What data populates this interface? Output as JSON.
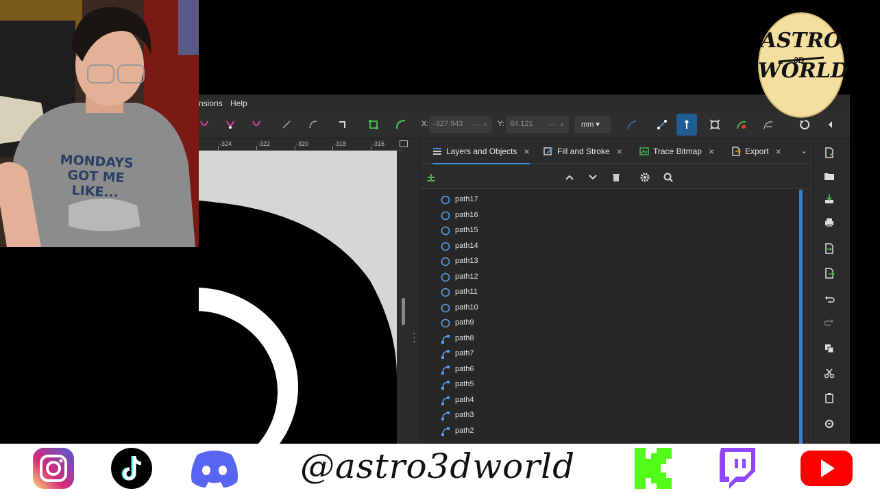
{
  "menu": {
    "partial_item": "nsions",
    "help": "Help"
  },
  "toolbar": {
    "x_label": "X:",
    "x_value": "-327.943",
    "y_label": "Y:",
    "y_value": "84.121",
    "unit": "mm ▾",
    "stepper_symbols": "— +",
    "icons": [
      "node-join-icon",
      "node-break-icon",
      "node-delete-icon",
      "segment-line-icon",
      "segment-curve-icon",
      "node-cusp-icon",
      "object-to-path-icon",
      "stroke-to-path-icon",
      "path-outline-icon",
      "bspline-icon",
      "show-handles-icon",
      "transform-handles-icon",
      "path-effect-icon",
      "clip-path-icon",
      "undo-icon",
      "collapse-icon"
    ]
  },
  "ruler": {
    "ticks": [
      "-324",
      "-322",
      "-320",
      "-318",
      "-316"
    ]
  },
  "panel": {
    "tabs": [
      {
        "label": "Layers and Objects",
        "icon": "layers-icon",
        "close": "×"
      },
      {
        "label": "Fill and Stroke",
        "icon": "fill-stroke-icon",
        "close": "×"
      },
      {
        "label": "Trace Bitmap",
        "icon": "trace-bitmap-icon",
        "close": "×"
      },
      {
        "label": "Export",
        "icon": "export-icon",
        "close": "×"
      }
    ],
    "more": "⌄",
    "layer_tools": [
      "add-layer-icon",
      "move-up-icon",
      "move-down-icon",
      "delete-icon",
      "settings-icon",
      "search-icon"
    ],
    "objects": [
      {
        "label": "path17",
        "icon": "circle-path-icon"
      },
      {
        "label": "path16",
        "icon": "circle-path-icon"
      },
      {
        "label": "path15",
        "icon": "circle-path-icon"
      },
      {
        "label": "path14",
        "icon": "circle-path-icon"
      },
      {
        "label": "path13",
        "icon": "circle-path-icon"
      },
      {
        "label": "path12",
        "icon": "circle-path-icon"
      },
      {
        "label": "path11",
        "icon": "circle-path-icon"
      },
      {
        "label": "path10",
        "icon": "circle-path-icon"
      },
      {
        "label": "path9",
        "icon": "circle-path-icon"
      },
      {
        "label": "path8",
        "icon": "bezier-path-icon"
      },
      {
        "label": "path7",
        "icon": "bezier-path-icon"
      },
      {
        "label": "path6",
        "icon": "bezier-path-icon"
      },
      {
        "label": "path5",
        "icon": "bezier-path-icon"
      },
      {
        "label": "path4",
        "icon": "bezier-path-icon"
      },
      {
        "label": "path3",
        "icon": "bezier-path-icon"
      },
      {
        "label": "path2",
        "icon": "bezier-path-icon"
      }
    ]
  },
  "commands": [
    "new-document-icon",
    "open-icon",
    "save-icon",
    "print-icon",
    "import-icon",
    "export-icon",
    "undo-icon",
    "redo-icon",
    "duplicate-icon",
    "cut-icon",
    "paste-icon",
    "zoom-icon"
  ],
  "webcam": {
    "shirt_text_1": "MONDAYS",
    "shirt_text_2": "GOT ME LIKE..."
  },
  "logo": {
    "line1": "ASTRO",
    "mid": "3D",
    "line2": "WORLD"
  },
  "social": {
    "handle": "@astro3dworld",
    "icons": [
      "instagram-icon",
      "tiktok-icon",
      "discord-icon",
      "kick-icon",
      "twitch-icon",
      "youtube-icon"
    ],
    "colors": {
      "instagram": "#e1306c",
      "discord": "#5865f2",
      "kick": "#53fc18",
      "twitch": "#9146ff",
      "youtube": "#ff0000"
    }
  },
  "colors": {
    "accent": "#3d8ee0",
    "panel_bg": "#2b2b2b",
    "list_bg": "#272727",
    "canvas_bg": "#d6d6d6"
  }
}
